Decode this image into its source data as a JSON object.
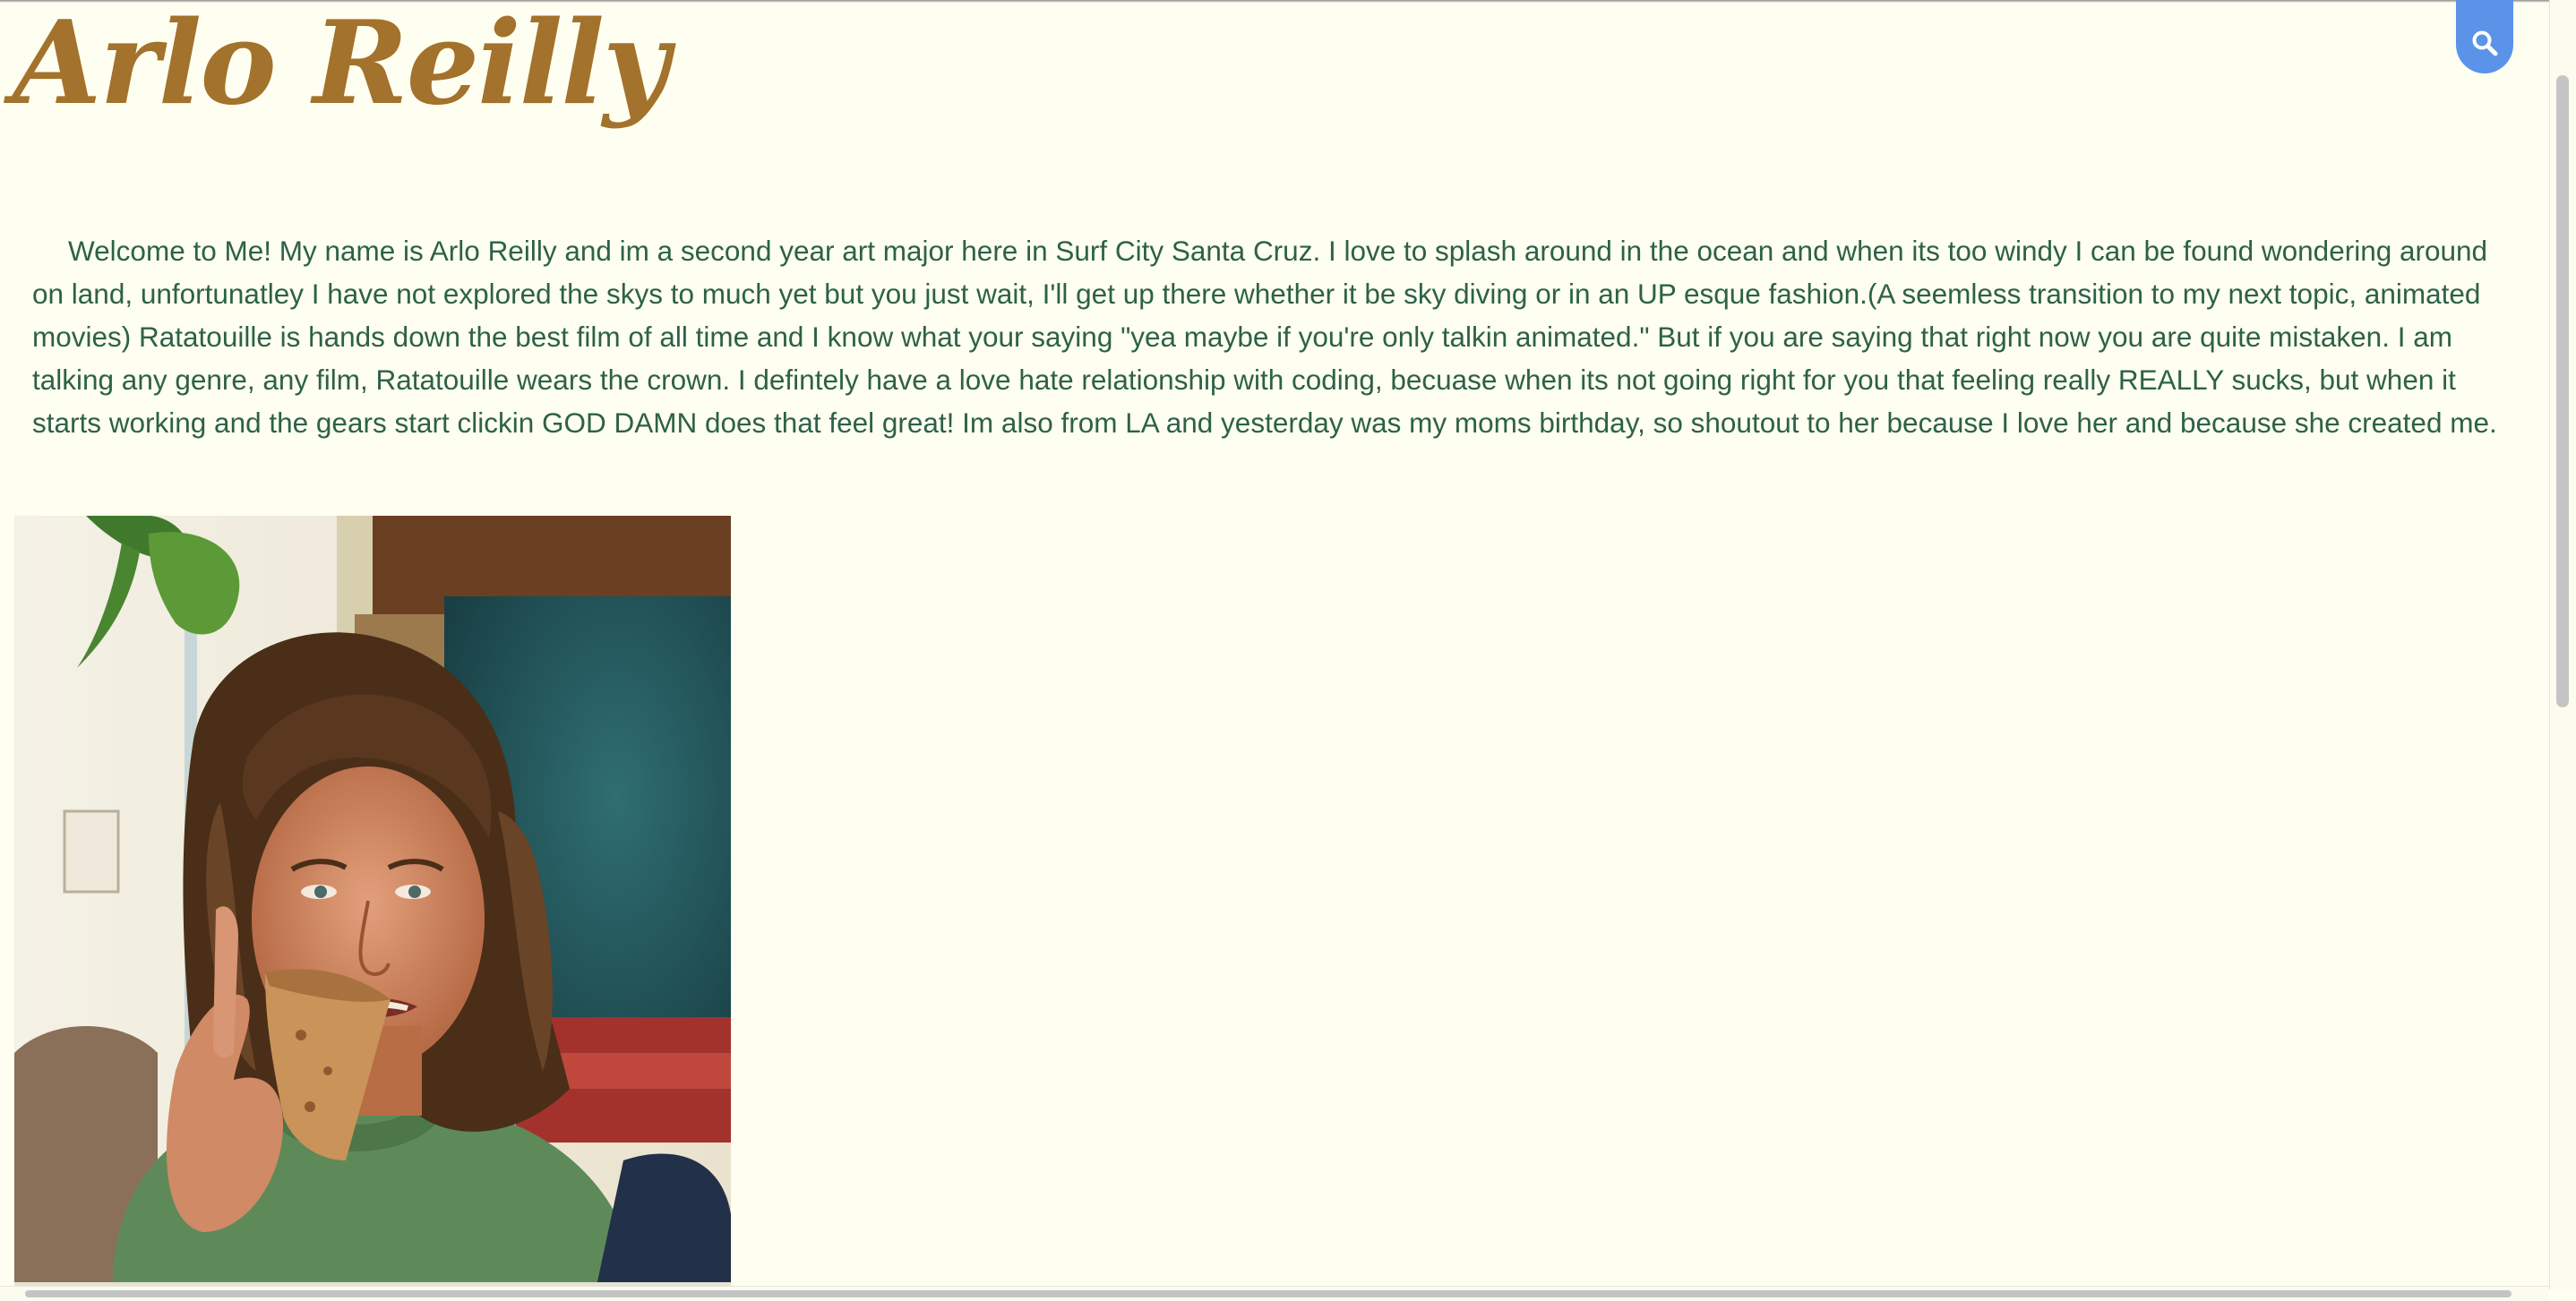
{
  "page": {
    "title": "Arlo Reilly",
    "intro": "Welcome to Me! My name is Arlo Reilly and im a second year art major here in Surf City Santa Cruz. I love to splash around in the ocean and when its too windy I can be found wondering around on land, unfortunatley I have not explored the skys to much yet but you just wait, I'll get up there whether it be sky diving or in an UP esque fashion.(A seemless transition to my next topic, animated movies) Ratatouille is hands down the best film of all time and I know what your saying \"yea maybe if you're only talkin animated.\" But if you are saying that right now you are quite mistaken. I am talking any genre, any film, Ratatouille wears the crown. I defintely have a love hate relationship with coding, becuase when its not going right for you that feeling really REALLY sucks, but when it starts working and the gears start clickin GOD DAMN does that feel great! Im also from LA and yesterday was my moms birthday, so shoutout to her because I love her and because she created me."
  },
  "search": {
    "icon": "search-icon"
  },
  "portrait": {
    "subject": "photo of long-haired man in green t-shirt eating a slice of pizza"
  },
  "colors": {
    "background": "#fefff0",
    "title": "#a3722c",
    "body_text": "#2d6148",
    "search_button": "#5b93e9"
  }
}
